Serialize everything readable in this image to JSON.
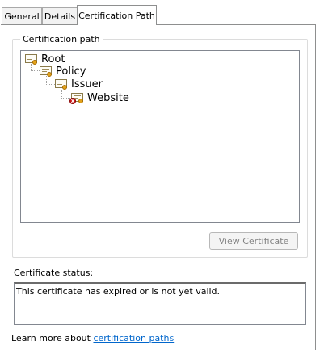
{
  "tabs": [
    {
      "label": "General"
    },
    {
      "label": "Details"
    },
    {
      "label": "Certification Path"
    }
  ],
  "active_tab": "Certification Path",
  "cert_path": {
    "title": "Certification path",
    "nodes": [
      {
        "label": "Root",
        "icon": "certificate-icon",
        "level": 0
      },
      {
        "label": "Policy",
        "icon": "certificate-icon",
        "level": 1
      },
      {
        "label": "Issuer",
        "icon": "certificate-icon",
        "level": 2
      },
      {
        "label": "Website",
        "icon": "certificate-error-icon",
        "level": 3
      }
    ]
  },
  "view_button": {
    "label": "View Certificate",
    "enabled": false
  },
  "status": {
    "label": "Certificate status:",
    "text": "This certificate has expired or is not yet valid."
  },
  "footer": {
    "prefix": "Learn more about ",
    "link": "certification paths"
  },
  "colors": {
    "link": "#0066cc",
    "seal": "#e3a21a",
    "error": "#d01818"
  }
}
